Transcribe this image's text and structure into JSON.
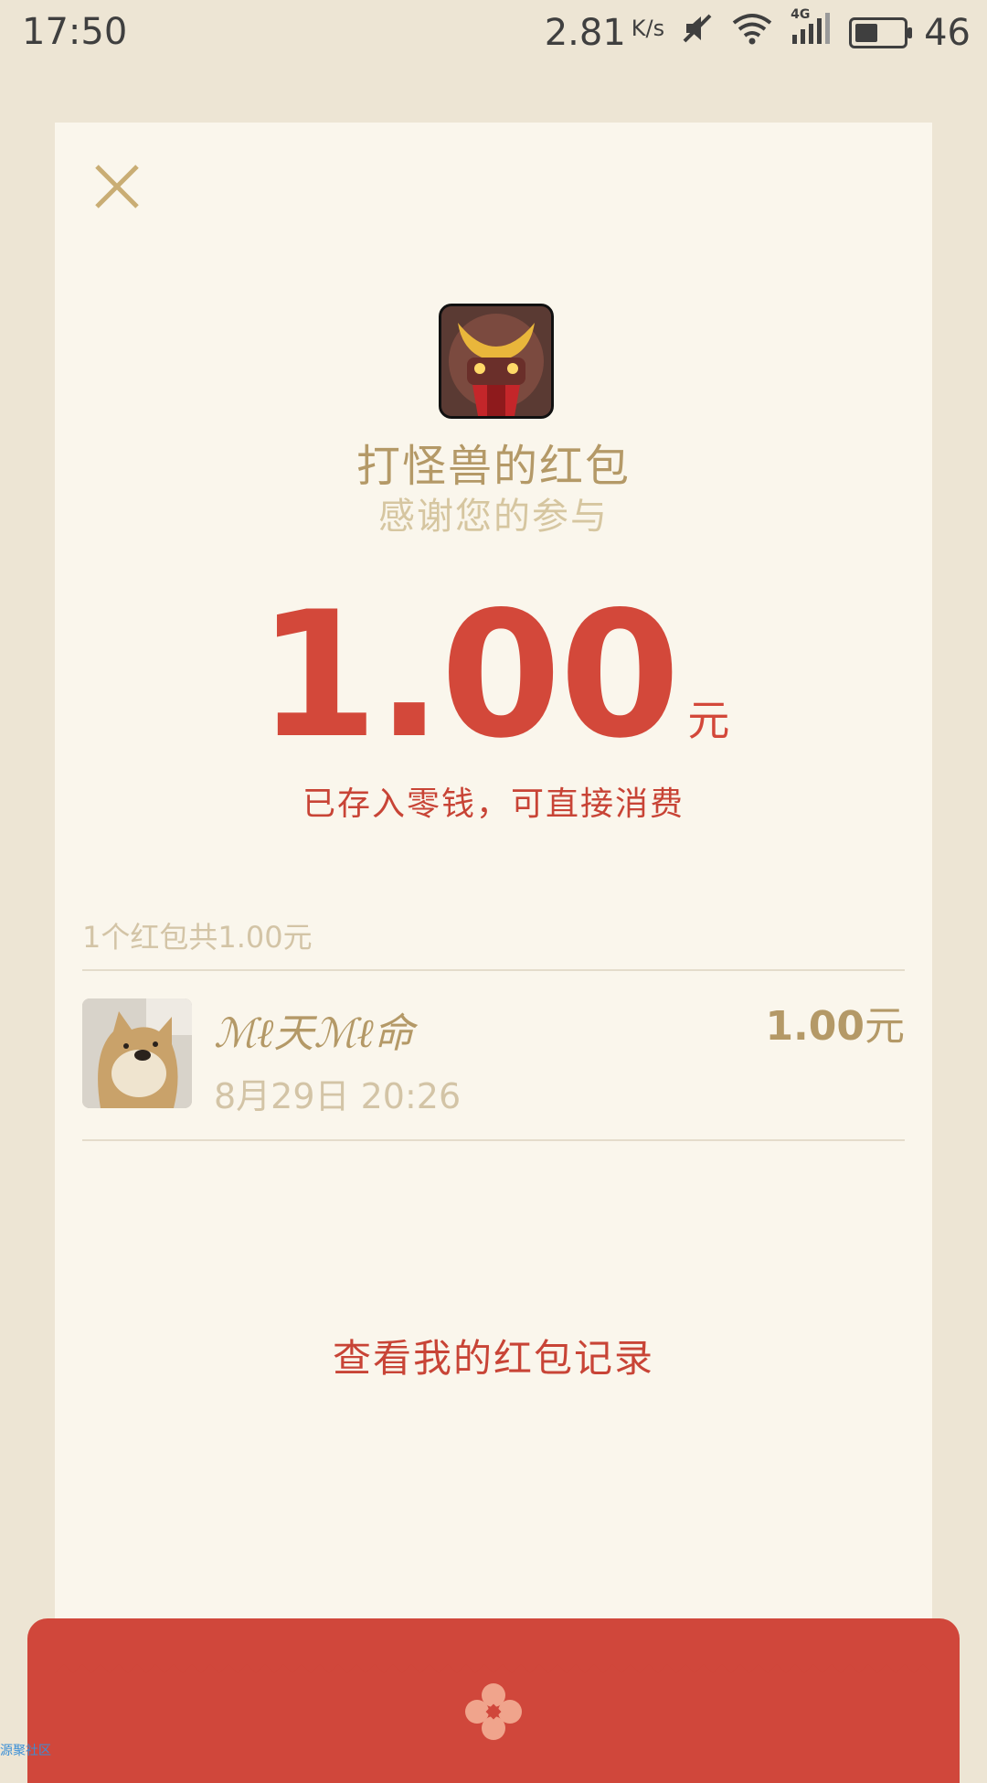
{
  "status_bar": {
    "time": "17:50",
    "speed": "2.81",
    "speed_unit": "K/s",
    "network": "4G",
    "battery_level": "46"
  },
  "card": {
    "title": "打怪兽的红包",
    "subtitle": "感谢您的参与",
    "amount": "1.00",
    "amount_unit": "元",
    "stored_note": "已存入零钱，可直接消费",
    "summary": "1个红包共1.00元",
    "receiver": {
      "name": "ℳℓ天ℳℓ命",
      "time": "8月29日  20:26",
      "amount": "1.00",
      "amount_unit": "元"
    },
    "history_link": "查看我的红包记录"
  },
  "watermark": "源聚社区",
  "colors": {
    "accent_red": "#d3483a",
    "gold_text": "#b49967",
    "card_bg": "#faf6ec",
    "page_bg": "#ede5d4"
  }
}
